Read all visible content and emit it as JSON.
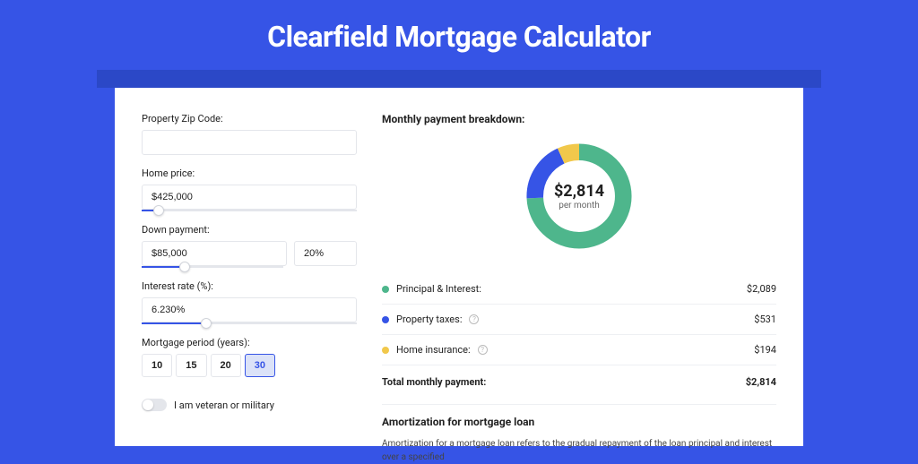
{
  "title": "Clearfield Mortgage Calculator",
  "colors": {
    "page_bg": "#3654e6",
    "band_bg": "#2b48c7",
    "card_bg": "#ffffff",
    "principal": "#4eb68c",
    "taxes": "#3654e6",
    "insurance": "#f1c84b"
  },
  "form": {
    "zip_label": "Property Zip Code:",
    "zip_value": "",
    "price_label": "Home price:",
    "price_value": "$425,000",
    "price_slider_pct": 8,
    "dp_label": "Down payment:",
    "dp_amount": "$85,000",
    "dp_pct": "20%",
    "dp_slider_pct": 20,
    "rate_label": "Interest rate (%):",
    "rate_value": "6.230%",
    "rate_slider_pct": 30,
    "period_label": "Mortgage period (years):",
    "periods": [
      "10",
      "15",
      "20",
      "30"
    ],
    "period_selected": 3,
    "veteran_label": "I am veteran or military"
  },
  "breakdown": {
    "title": "Monthly payment breakdown:",
    "center_amount": "$2,814",
    "center_sub": "per month",
    "rows": [
      {
        "label": "Principal & Interest:",
        "value": "$2,089",
        "info": false
      },
      {
        "label": "Property taxes:",
        "value": "$531",
        "info": true
      },
      {
        "label": "Home insurance:",
        "value": "$194",
        "info": true
      }
    ],
    "total_label": "Total monthly payment:",
    "total_value": "$2,814"
  },
  "chart_data": {
    "type": "pie",
    "title": "Monthly payment breakdown",
    "series": [
      {
        "name": "Principal & Interest",
        "value": 2089,
        "color": "#4eb68c"
      },
      {
        "name": "Property taxes",
        "value": 531,
        "color": "#3654e6"
      },
      {
        "name": "Home insurance",
        "value": 194,
        "color": "#f1c84b"
      }
    ],
    "total": 2814
  },
  "amortization": {
    "title": "Amortization for mortgage loan",
    "text": "Amortization for a mortgage loan refers to the gradual repayment of the loan principal and interest over a specified"
  }
}
